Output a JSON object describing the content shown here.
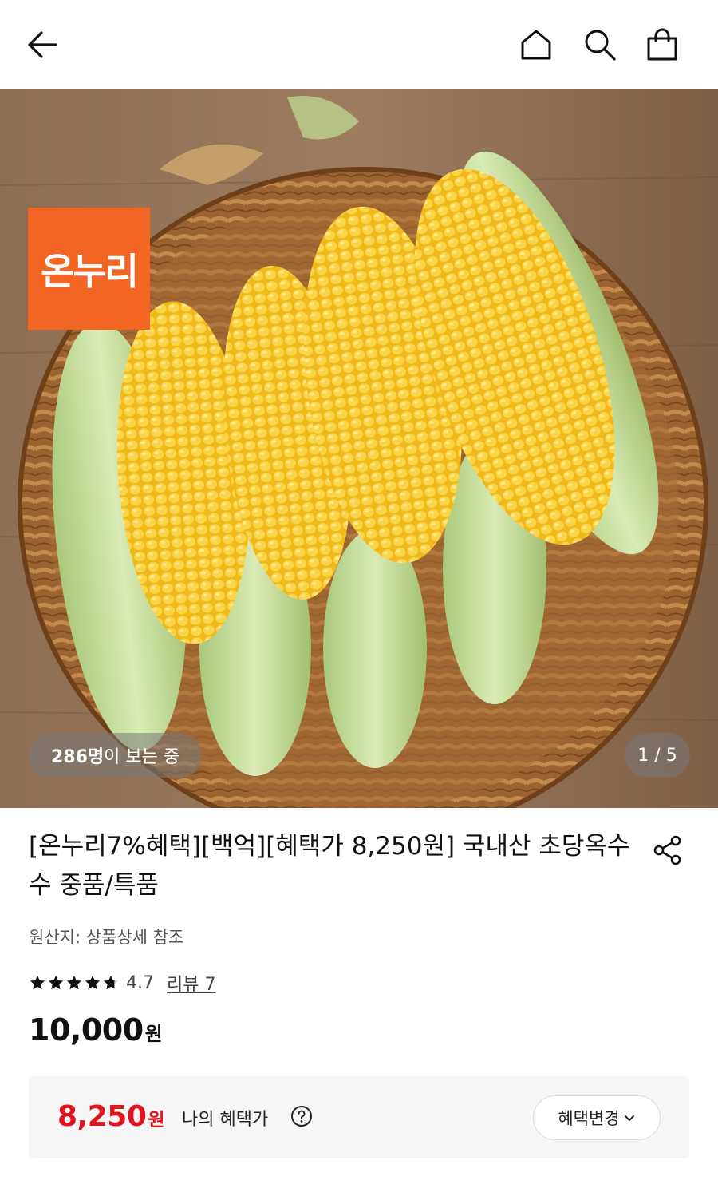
{
  "header": {
    "back_icon": "arrow-left-icon",
    "home_icon": "home-icon",
    "search_icon": "search-icon",
    "cart_icon": "shopping-bag-icon"
  },
  "hero": {
    "brand_logo_text": "온누리",
    "viewer_count": "286명",
    "viewer_suffix": "이 보는 중",
    "pager": "1 / 5",
    "colors": {
      "brand": "#f26522",
      "corn": "#f5c31c",
      "husk": "#b9d68c",
      "basket": "#a06a35",
      "wood": "#8b6a4e"
    }
  },
  "product": {
    "title": "[온누리7%혜택][백억][혜택가 8,250원] 국내산 초당옥수수 중품/특품",
    "share_icon": "share-icon",
    "origin": "원산지: 상품상세 참조",
    "rating": "4.7",
    "rating_stars": 4.7,
    "review_link": "리뷰 7",
    "price": "10,000",
    "price_unit": "원"
  },
  "benefit": {
    "price": "8,250",
    "price_unit": "원",
    "label": "나의 혜택가",
    "help_icon": "question-circle-icon",
    "change_button": "혜택변경",
    "accent": "#e0141f"
  }
}
